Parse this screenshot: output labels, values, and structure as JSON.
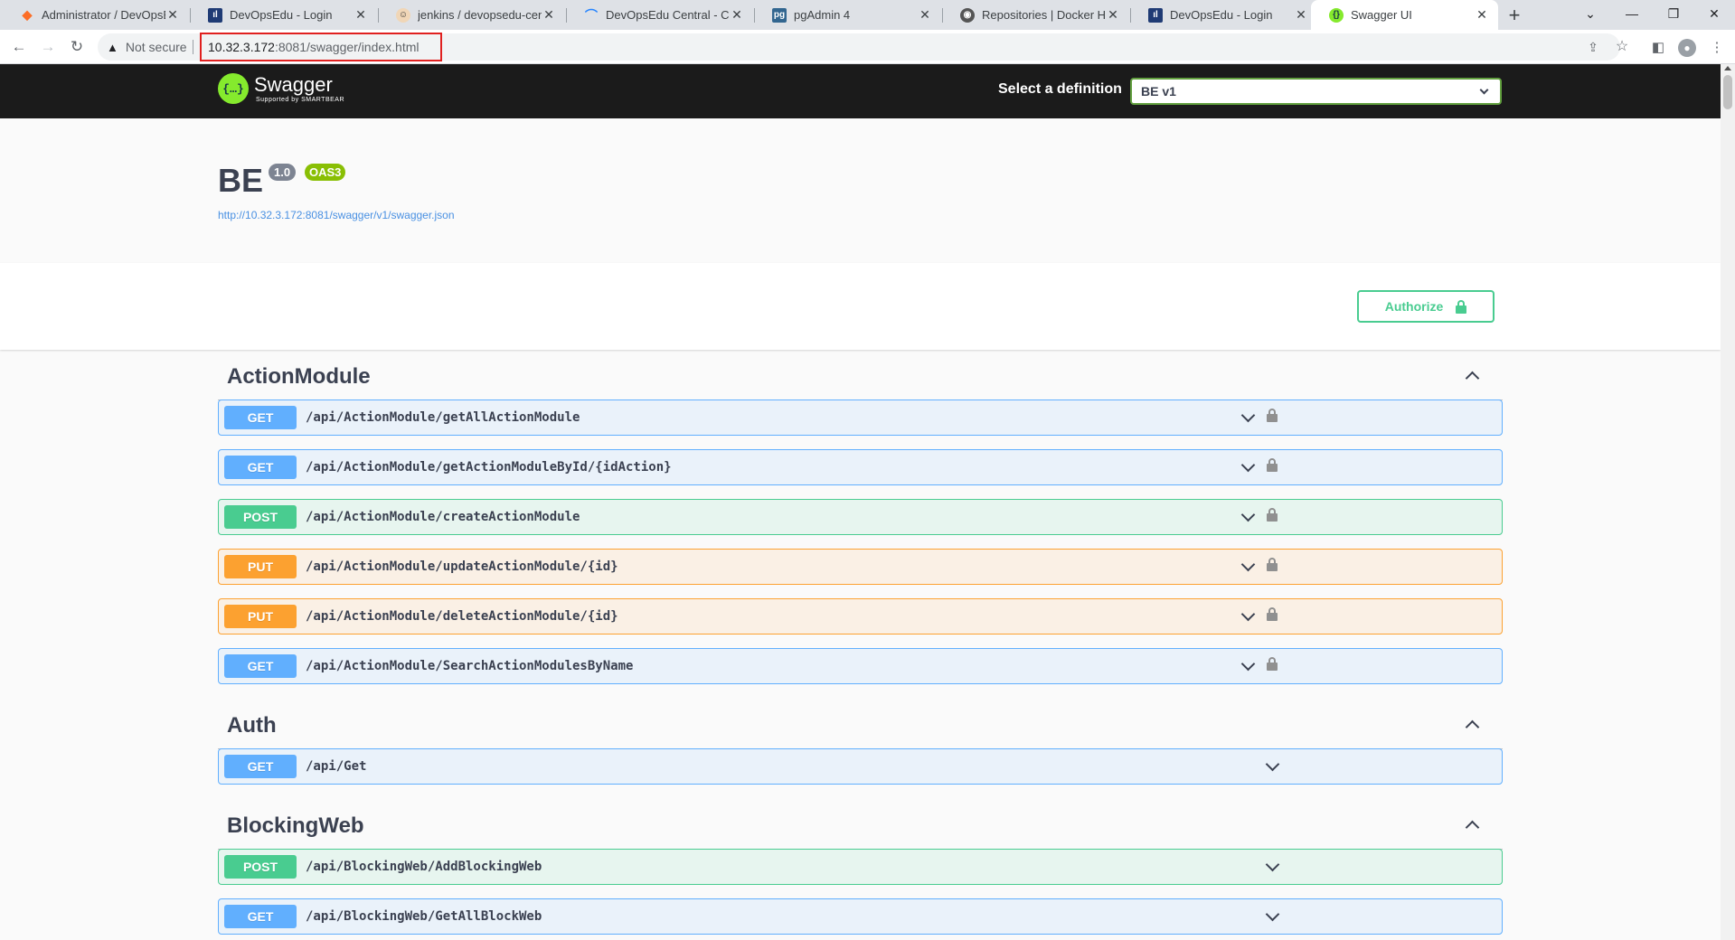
{
  "browser": {
    "tabs": [
      {
        "title": "Administrator / DevOpsEdu",
        "icon": "gitlab-icon",
        "color": "#fc6d26"
      },
      {
        "title": "DevOpsEdu - Login",
        "icon": "app-icon",
        "color": "#1f3b75"
      },
      {
        "title": "jenkins / devopsedu-central",
        "icon": "jenkins-icon",
        "color": "#d24939"
      },
      {
        "title": "DevOpsEdu Central - Code",
        "icon": "sourcetree-icon",
        "color": "#2684ff"
      },
      {
        "title": "pgAdmin 4",
        "icon": "pgadmin-icon",
        "color": "#326690"
      },
      {
        "title": "Repositories | Docker Hub",
        "icon": "docker-icon",
        "color": "#555555"
      },
      {
        "title": "DevOpsEdu - Login",
        "icon": "app-icon",
        "color": "#1f3b75"
      },
      {
        "title": "Swagger UI",
        "icon": "swagger-icon",
        "color": "#85ea2d"
      }
    ],
    "security_label": "Not secure",
    "url_host": "10.32.3.172",
    "url_rest": ":8081/swagger/index.html"
  },
  "swagger": {
    "logo_word": "Swagger",
    "logo_sub": "Supported by SMARTBEAR",
    "definition_label": "Select a definition",
    "definition_selected": "BE v1",
    "api_title": "BE",
    "version": "1.0",
    "oas": "OAS3",
    "spec_url": "http://10.32.3.172:8081/swagger/v1/swagger.json",
    "authorize_label": "Authorize",
    "colors": {
      "get": "#61affe",
      "post": "#49cc90",
      "put": "#fca130",
      "oas": "#89bf04"
    }
  },
  "sections": [
    {
      "name": "ActionModule",
      "ops": [
        {
          "method": "GET",
          "path": "/api/ActionModule/getAllActionModule",
          "locked": true
        },
        {
          "method": "GET",
          "path": "/api/ActionModule/getActionModuleById/{idAction}",
          "locked": true
        },
        {
          "method": "POST",
          "path": "/api/ActionModule/createActionModule",
          "locked": true
        },
        {
          "method": "PUT",
          "path": "/api/ActionModule/updateActionModule/{id}",
          "locked": true
        },
        {
          "method": "PUT",
          "path": "/api/ActionModule/deleteActionModule/{id}",
          "locked": true
        },
        {
          "method": "GET",
          "path": "/api/ActionModule/SearchActionModulesByName",
          "locked": true
        }
      ]
    },
    {
      "name": "Auth",
      "ops": [
        {
          "method": "GET",
          "path": "/api/Get",
          "locked": false
        }
      ]
    },
    {
      "name": "BlockingWeb",
      "ops": [
        {
          "method": "POST",
          "path": "/api/BlockingWeb/AddBlockingWeb",
          "locked": false
        },
        {
          "method": "GET",
          "path": "/api/BlockingWeb/GetAllBlockWeb",
          "locked": false
        }
      ]
    }
  ]
}
